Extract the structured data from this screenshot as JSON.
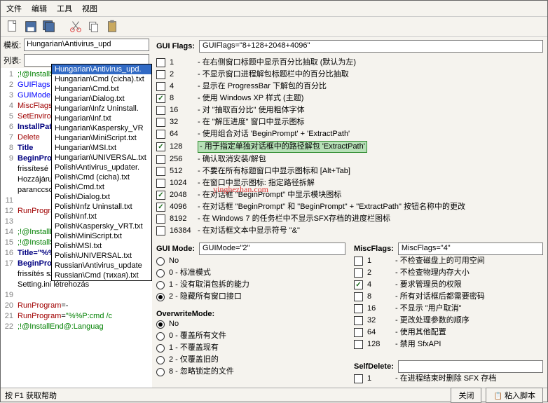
{
  "menu": {
    "file": "文件",
    "edit": "编辑",
    "tools": "工具",
    "view": "视图"
  },
  "left": {
    "tpl_label": "模板:",
    "tpl_value": "Hungarian\\Antivirus_upd",
    "list_label": "列表:",
    "dropdown": {
      "sel_index": 0,
      "items": [
        "Hungarian\\Antivirus_upd.",
        "Hungarian\\Cmd (cicha).txt",
        "Hungarian\\Cmd.txt",
        "Hungarian\\Dialog.txt",
        "Hungarian\\Infz Uninstall.",
        "Hungarian\\Inf.txt",
        "Hungarian\\Kaspersky_VR",
        "Hungarian\\MiniScript.txt",
        "Hungarian\\MSI.txt",
        "Hungarian\\UNIVERSAL.txt",
        "Polish\\Antivirus_updater.",
        "Polish\\Cmd (cicha).txt",
        "Polish\\Cmd.txt",
        "Polish\\Dialog.txt",
        "Polish\\Infz Uninstall.txt",
        "Polish\\Inf.txt",
        "Polish\\Kaspersky_VRT.txt",
        "Polish\\MiniScript.txt",
        "Polish\\MSI.txt",
        "Polish\\UNIVERSAL.txt",
        "Russian\\Antivirus_update",
        "Russian\\Cmd (тихая).txt"
      ]
    },
    "editor": [
      {
        "n": "1",
        "t": ";!@InstallS",
        "cls": "c-gr"
      },
      {
        "n": "2",
        "t": "GUIFlags",
        "cls": "c-bl"
      },
      {
        "n": "3",
        "t": "GUIMode",
        "cls": "c-bl"
      },
      {
        "n": "4",
        "t": "MiscFlags",
        "cls": "c-rd"
      },
      {
        "n": "5",
        "t": "SetEnvironm",
        "cls": "c-rd"
      },
      {
        "n": "6",
        "t": "InstallPath",
        "cls": "c-nv"
      },
      {
        "n": "7",
        "t": "Delete",
        "cls": "c-rd"
      },
      {
        "n": "8",
        "t": "Title",
        "cls": "c-nv"
      },
      {
        "n": "9",
        "t": "BeginPrompt",
        "cls": "c-nv"
      },
      {
        "n": "",
        "t": "frissítesé",
        "cls": ""
      },
      {
        "n": "",
        "t": "Hozzájárul",
        "cls": ""
      },
      {
        "n": "",
        "t": "paranccsor",
        "cls": ""
      },
      {
        "n": "11",
        "t": "",
        "cls": ""
      },
      {
        "n": "12",
        "t": "RunProgram",
        "cls": "c-rd"
      },
      {
        "n": "13",
        "t": "",
        "cls": ""
      },
      {
        "n": "14",
        "t": ";!@InstallE",
        "cls": "c-gr"
      },
      {
        "n": "15",
        "t": ";!@InstallS",
        "cls": "c-gr"
      },
      {
        "n": "16",
        "t": "Title=\"%%L",
        "cls": "c-nv"
      },
      {
        "n": "17",
        "t": "BeginPrompt",
        "cls": "c-nv"
      },
      {
        "n": "",
        "t": "frissítés szamítógep",
        "cls": ""
      },
      {
        "n": "",
        "t": "Setting.ini létrehozás",
        "cls": ""
      },
      {
        "n": "19",
        "t": "",
        "cls": ""
      },
      {
        "n": "20",
        "raw": "<span class='c-rd'>RunProgram</span>=-"
      },
      {
        "n": "21",
        "raw": "<span class='c-rd'>RunProgram</span>=<span class='c-gr'>\"%%P:cmd /c</span>"
      },
      {
        "n": "22",
        "raw": "<span class='c-gr'>;!@InstallEnd@:Languag</span>"
      }
    ]
  },
  "right": {
    "guiflags": {
      "label": "GUI Flags:",
      "value": "GUIFlags=\"8+128+2048+4096\""
    },
    "flags": [
      {
        "v": "1",
        "chk": false,
        "t": "- 在右侧窗口标题中显示百分比抽取 (默认为左)"
      },
      {
        "v": "2",
        "chk": false,
        "t": "- 不显示窗口进程解包标题栏中的百分比抽取"
      },
      {
        "v": "4",
        "chk": false,
        "t": "- 显示在 ProgressBar 下解包的百分比"
      },
      {
        "v": "8",
        "chk": true,
        "t": "- 使用 Windows XP 样式 (主题)"
      },
      {
        "v": "16",
        "chk": false,
        "t": "- 对 \"抽取百分比\" 使用粗体字体"
      },
      {
        "v": "32",
        "chk": false,
        "t": "- 在 \"解压进度\" 窗口中显示图标"
      },
      {
        "v": "64",
        "chk": false,
        "t": "- 使用组合对话 'BeginPrompt' + 'ExtractPath'"
      },
      {
        "v": "128",
        "chk": true,
        "hl": true,
        "t": "- 用于指定单独对话框中的路径解包 'ExtractPath'"
      },
      {
        "v": "256",
        "chk": false,
        "t": "- 确认取消安装/解包"
      },
      {
        "v": "512",
        "chk": false,
        "t": "- 不要在所有标题窗口中显示图标和 [Alt+Tab]"
      },
      {
        "v": "1024",
        "chk": false,
        "t": "- 在窗口中显示图标: 指定路径拆解"
      },
      {
        "v": "2048",
        "chk": true,
        "t": "- 在对话框 \"BeginPrompt\" 中显示模块图标"
      },
      {
        "v": "4096",
        "chk": true,
        "t": "- 在对话框 \"BeginPrompt\" 和 \"BeginPrompt\" + \"ExtractPath\" 按钮名称中的更改"
      },
      {
        "v": "8192",
        "chk": false,
        "t": "- 在 Windows 7 的任务栏中不显示SFX存档的进度栏图标"
      },
      {
        "v": "16384",
        "chk": false,
        "t": "- 在对话框文本中显示符号 \"&\""
      }
    ],
    "guimode": {
      "label": "GUI Mode:",
      "value": "GUIMode=\"2\"",
      "opts": [
        {
          "t": "No",
          "chk": false
        },
        {
          "t": "0 - 标准模式",
          "chk": false
        },
        {
          "t": "1 - 没有取消包拆的能力",
          "chk": false
        },
        {
          "t": "2 - 隐藏所有窗口接口",
          "chk": true
        }
      ]
    },
    "overwrite": {
      "label": "OverwriteMode:",
      "opts": [
        {
          "t": "No",
          "chk": true
        },
        {
          "t": "0 - 覆盖所有文件",
          "chk": false
        },
        {
          "t": "1 - 不覆盖现有",
          "chk": false
        },
        {
          "t": "2 - 仅覆盖旧的",
          "chk": false
        },
        {
          "t": "8 - 忽略锁定的文件",
          "chk": false
        }
      ]
    },
    "miscflags": {
      "label": "MiscFlags:",
      "value": "MiscFlags=\"4\"",
      "opts": [
        {
          "v": "1",
          "chk": false,
          "t": "- 不检查磁盘上的可用空间"
        },
        {
          "v": "2",
          "chk": false,
          "t": "- 不检查物理内存大小"
        },
        {
          "v": "4",
          "chk": true,
          "t": "- 要求管理员的权限"
        },
        {
          "v": "8",
          "chk": false,
          "t": "- 所有对话框后都需要密码"
        },
        {
          "v": "16",
          "chk": false,
          "t": "- 不显示 \"用户取消\""
        },
        {
          "v": "32",
          "chk": false,
          "t": "- 更改处理参数的顺序"
        },
        {
          "v": "64",
          "chk": false,
          "t": "- 使用其他配置"
        },
        {
          "v": "128",
          "chk": false,
          "t": "- 禁用 SfxAPI"
        }
      ]
    },
    "selfdelete": {
      "label": "SelfDelete:",
      "value": "",
      "opt": {
        "v": "1",
        "chk": false,
        "t": "- 在进程结束时删除 SFX 存档"
      }
    }
  },
  "status": {
    "help": "按 F1 获取帮助",
    "close": "关闭",
    "paste": "粘入脚本"
  },
  "watermark": "yinghezhan.com"
}
